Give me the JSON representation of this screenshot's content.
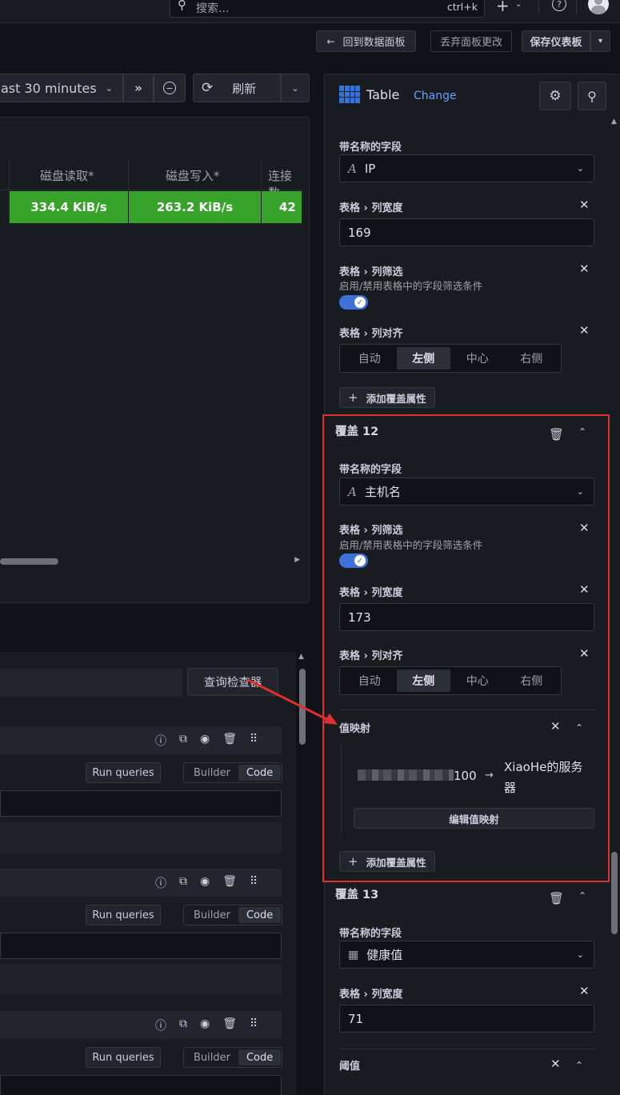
{
  "topbar": {
    "search_placeholder": "搜索...",
    "search_shortcut": "ctrl+k",
    "plus_icon": "plus-icon",
    "help_icon": "help-icon"
  },
  "toolbar": {
    "back_label": "回到数据面板",
    "discard_label": "丢弃面板更改",
    "save_label": "保存仪表板"
  },
  "timebar": {
    "time_range": "ast 30 minutes",
    "refresh_label": "刷新"
  },
  "table_preview": {
    "headers": [
      "磁盘读取*",
      "磁盘写入*",
      "连接数"
    ],
    "row": [
      "334.4 KiB/s",
      "263.2 KiB/s",
      "42"
    ],
    "cell_color": "#37a32a"
  },
  "queries": {
    "inspector_label": "查询检查器",
    "run_label": "Run queries",
    "builder_label": "Builder",
    "code_label": "Code"
  },
  "options_header": {
    "viz_name": "Table",
    "change_label": "Change"
  },
  "override_prev": {
    "field_label": "带名称的字段",
    "field_value": "IP",
    "width_label_a": "表格",
    "width_label_b": "列宽度",
    "width_value": "169",
    "filter_label_a": "表格",
    "filter_label_b": "列筛选",
    "filter_desc": "启用/禁用表格中的字段筛选条件",
    "align_label_a": "表格",
    "align_label_b": "列对齐",
    "align_options": [
      "自动",
      "左侧",
      "中心",
      "右侧"
    ],
    "add_label": "添加覆盖属性"
  },
  "override12": {
    "title": "覆盖 12",
    "field_label": "带名称的字段",
    "field_value": "主机名",
    "filter_label_a": "表格",
    "filter_label_b": "列筛选",
    "filter_desc": "启用/禁用表格中的字段筛选条件",
    "width_label_a": "表格",
    "width_label_b": "列宽度",
    "width_value": "173",
    "align_label_a": "表格",
    "align_label_b": "列对齐",
    "align_options": [
      "自动",
      "左侧",
      "中心",
      "右侧"
    ],
    "mapping_label": "值映射",
    "mapping_from": "100",
    "mapping_to_a": "XiaoHe的服务",
    "mapping_to_b": "器",
    "edit_mapping_label": "编辑值映射",
    "add_label": "添加覆盖属性",
    "highlight_color": "#e02f2f"
  },
  "override13": {
    "title": "覆盖 13",
    "field_label": "带名称的字段",
    "field_value": "健康值",
    "width_label_a": "表格",
    "width_label_b": "列宽度",
    "width_value": "71",
    "threshold_label": "阈值"
  }
}
